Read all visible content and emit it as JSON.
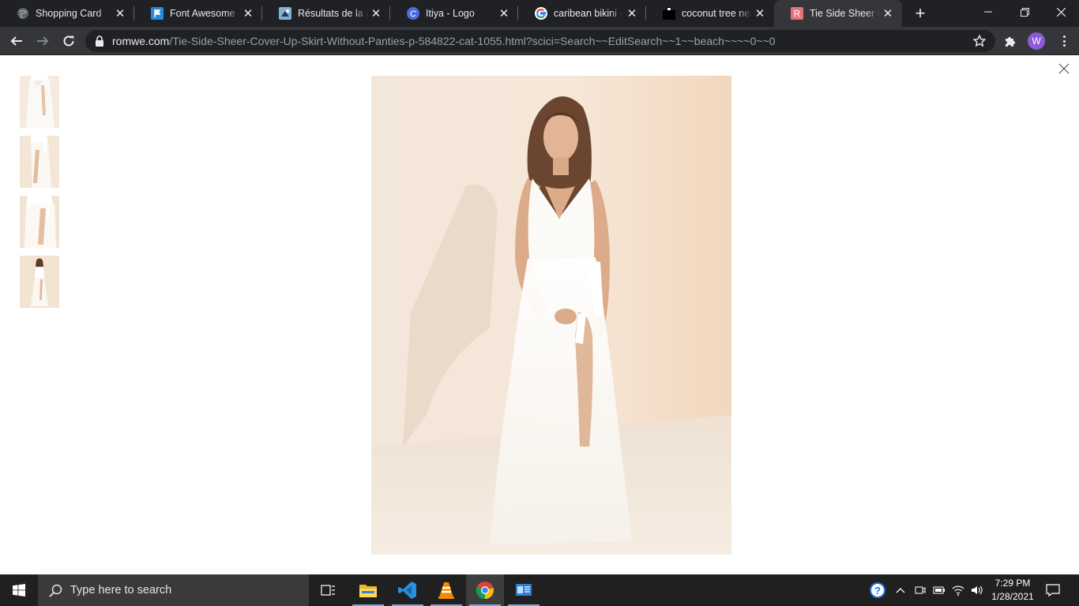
{
  "browser": {
    "tabs": [
      {
        "title": "Shopping Card",
        "favicon": "globe-icon"
      },
      {
        "title": "Font Awesome",
        "favicon": "flag-icon"
      },
      {
        "title": "Résultats de la recherche",
        "favicon": "image-search-icon"
      },
      {
        "title": "Itiya - Logo",
        "favicon": "canva-icon"
      },
      {
        "title": "caribean bikini - Recherche",
        "favicon": "google-icon"
      },
      {
        "title": "coconut tree near",
        "favicon": "black-logo-icon"
      },
      {
        "title": "Tie Side Sheer Cover Up Skirt",
        "favicon": "romwe-icon",
        "active": true
      }
    ],
    "url_host": "romwe.com",
    "url_path": "/Tie-Side-Sheer-Cover-Up-Skirt-Without-Panties-p-584822-cat-1055.html?scici=Search~~EditSearch~~1~~beach~~~~0~~0",
    "profile_initial": "W",
    "profile_color": "#8e5ad6"
  },
  "gallery": {
    "thumbnails": [
      {
        "label": "thumbnail-1"
      },
      {
        "label": "thumbnail-2"
      },
      {
        "label": "thumbnail-3"
      },
      {
        "label": "thumbnail-4",
        "selected": true
      }
    ]
  },
  "taskbar": {
    "search_placeholder": "Type here to search",
    "time": "7:29 PM",
    "date": "1/28/2021",
    "apps": [
      "task-view-icon",
      "file-explorer-icon",
      "vscode-icon",
      "vlc-icon",
      "chrome-icon",
      "control-panel-icon"
    ]
  }
}
